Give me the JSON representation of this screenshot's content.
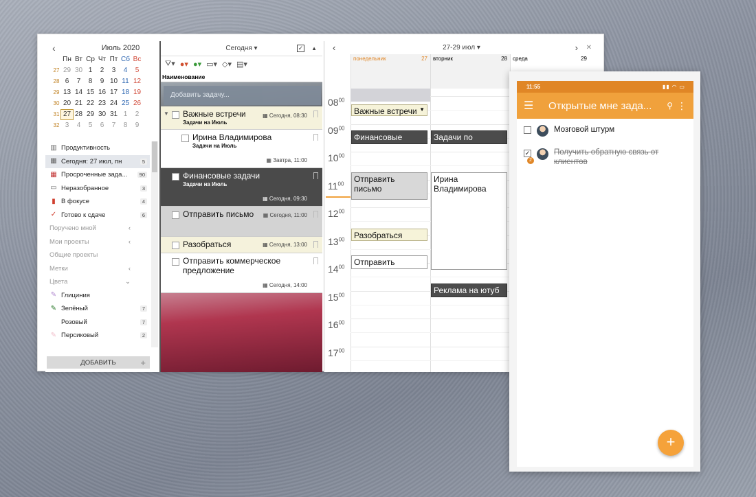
{
  "calendar": {
    "month": "Июль 2020",
    "dow": [
      "Пн",
      "Вт",
      "Ср",
      "Чт",
      "Пт",
      "Сб",
      "Вс"
    ],
    "weeks": [
      {
        "wk": "27",
        "days": [
          "29",
          "30",
          "1",
          "2",
          "3",
          "4",
          "5"
        ]
      },
      {
        "wk": "28",
        "days": [
          "6",
          "7",
          "8",
          "9",
          "10",
          "11",
          "12"
        ]
      },
      {
        "wk": "29",
        "days": [
          "13",
          "14",
          "15",
          "16",
          "17",
          "18",
          "19"
        ]
      },
      {
        "wk": "30",
        "days": [
          "20",
          "21",
          "22",
          "23",
          "24",
          "25",
          "26"
        ]
      },
      {
        "wk": "31",
        "days": [
          "27",
          "28",
          "29",
          "30",
          "31",
          "1",
          "2"
        ]
      },
      {
        "wk": "32",
        "days": [
          "3",
          "4",
          "5",
          "6",
          "7",
          "8",
          "9"
        ]
      }
    ]
  },
  "nav": {
    "items": [
      {
        "label": "Продуктивность",
        "icon": "chart-icon",
        "count": ""
      },
      {
        "label": "Сегодня: 27 июл, пн",
        "icon": "calendar-icon",
        "count": "5"
      },
      {
        "label": "Просроченные зада...",
        "icon": "overdue-calendar-icon",
        "count": "90"
      },
      {
        "label": "Неразобранное",
        "icon": "inbox-icon",
        "count": "3"
      },
      {
        "label": "В фокусе",
        "icon": "bookmark-icon",
        "count": "4"
      },
      {
        "label": "Готово к сдаче",
        "icon": "check-icon",
        "count": "6"
      },
      {
        "label": "Поручено мной",
        "count": ""
      },
      {
        "label": "Мои проекты",
        "count": ""
      },
      {
        "label": "Общие проекты",
        "count": ""
      },
      {
        "label": "Метки",
        "count": ""
      },
      {
        "label": "Цвета",
        "count": ""
      },
      {
        "label": "Глициния",
        "icon": "brush-icon",
        "count": ""
      },
      {
        "label": "Зелёный",
        "icon": "brush-icon",
        "count": "7"
      },
      {
        "label": "Розовый",
        "count": "7"
      },
      {
        "label": "Персиковый",
        "icon": "brush-icon",
        "count": "2"
      }
    ],
    "add_label": "ДОБАВИТЬ"
  },
  "tasks": {
    "filter": "Сегодня",
    "column": "Наименование",
    "add_placeholder": "Добавить задачу...",
    "list": [
      {
        "title": "Важные встречи",
        "sub": "Задачи на Июль",
        "date": "Сегодня, 08:30"
      },
      {
        "title": "Ирина Владимирова",
        "sub": "Задачи на Июль",
        "date": "Завтра, 11:00"
      },
      {
        "title": "Финансовые задачи",
        "sub": "Задачи на Июль",
        "date": "Сегодня, 09:30"
      },
      {
        "title": "Отправить письмо",
        "sub": "",
        "date": "Сегодня, 11:00"
      },
      {
        "title": "Разобраться",
        "sub": "",
        "date": "Сегодня, 13:00"
      },
      {
        "title": "Отправить коммерческое",
        "title2": "предложение",
        "sub": "",
        "date": "Сегодня, 14:00"
      }
    ]
  },
  "schedule": {
    "range": "27-29 июл",
    "days": [
      {
        "name": "понедельник",
        "num": "27"
      },
      {
        "name": "вторник",
        "num": "28"
      },
      {
        "name": "среда",
        "num": "29"
      }
    ],
    "hours": [
      "08",
      "09",
      "10",
      "11",
      "12",
      "13",
      "14",
      "15",
      "16",
      "17"
    ],
    "minutes": "00",
    "events": [
      "Важные встречи",
      "Финансовые",
      "Задачи по",
      "Отправить письмо",
      "Ирина",
      "Владимирова",
      "Разобраться",
      "Отправить",
      "Реклама на ютуб"
    ]
  },
  "mobile": {
    "time": "11:55",
    "title": "Открытые мне зада...",
    "tasks": [
      {
        "text": "Мозговой штурм"
      },
      {
        "text": "Получить обратную связь от",
        "text2": "клиентов",
        "badge": "2"
      }
    ],
    "fab": "+"
  }
}
